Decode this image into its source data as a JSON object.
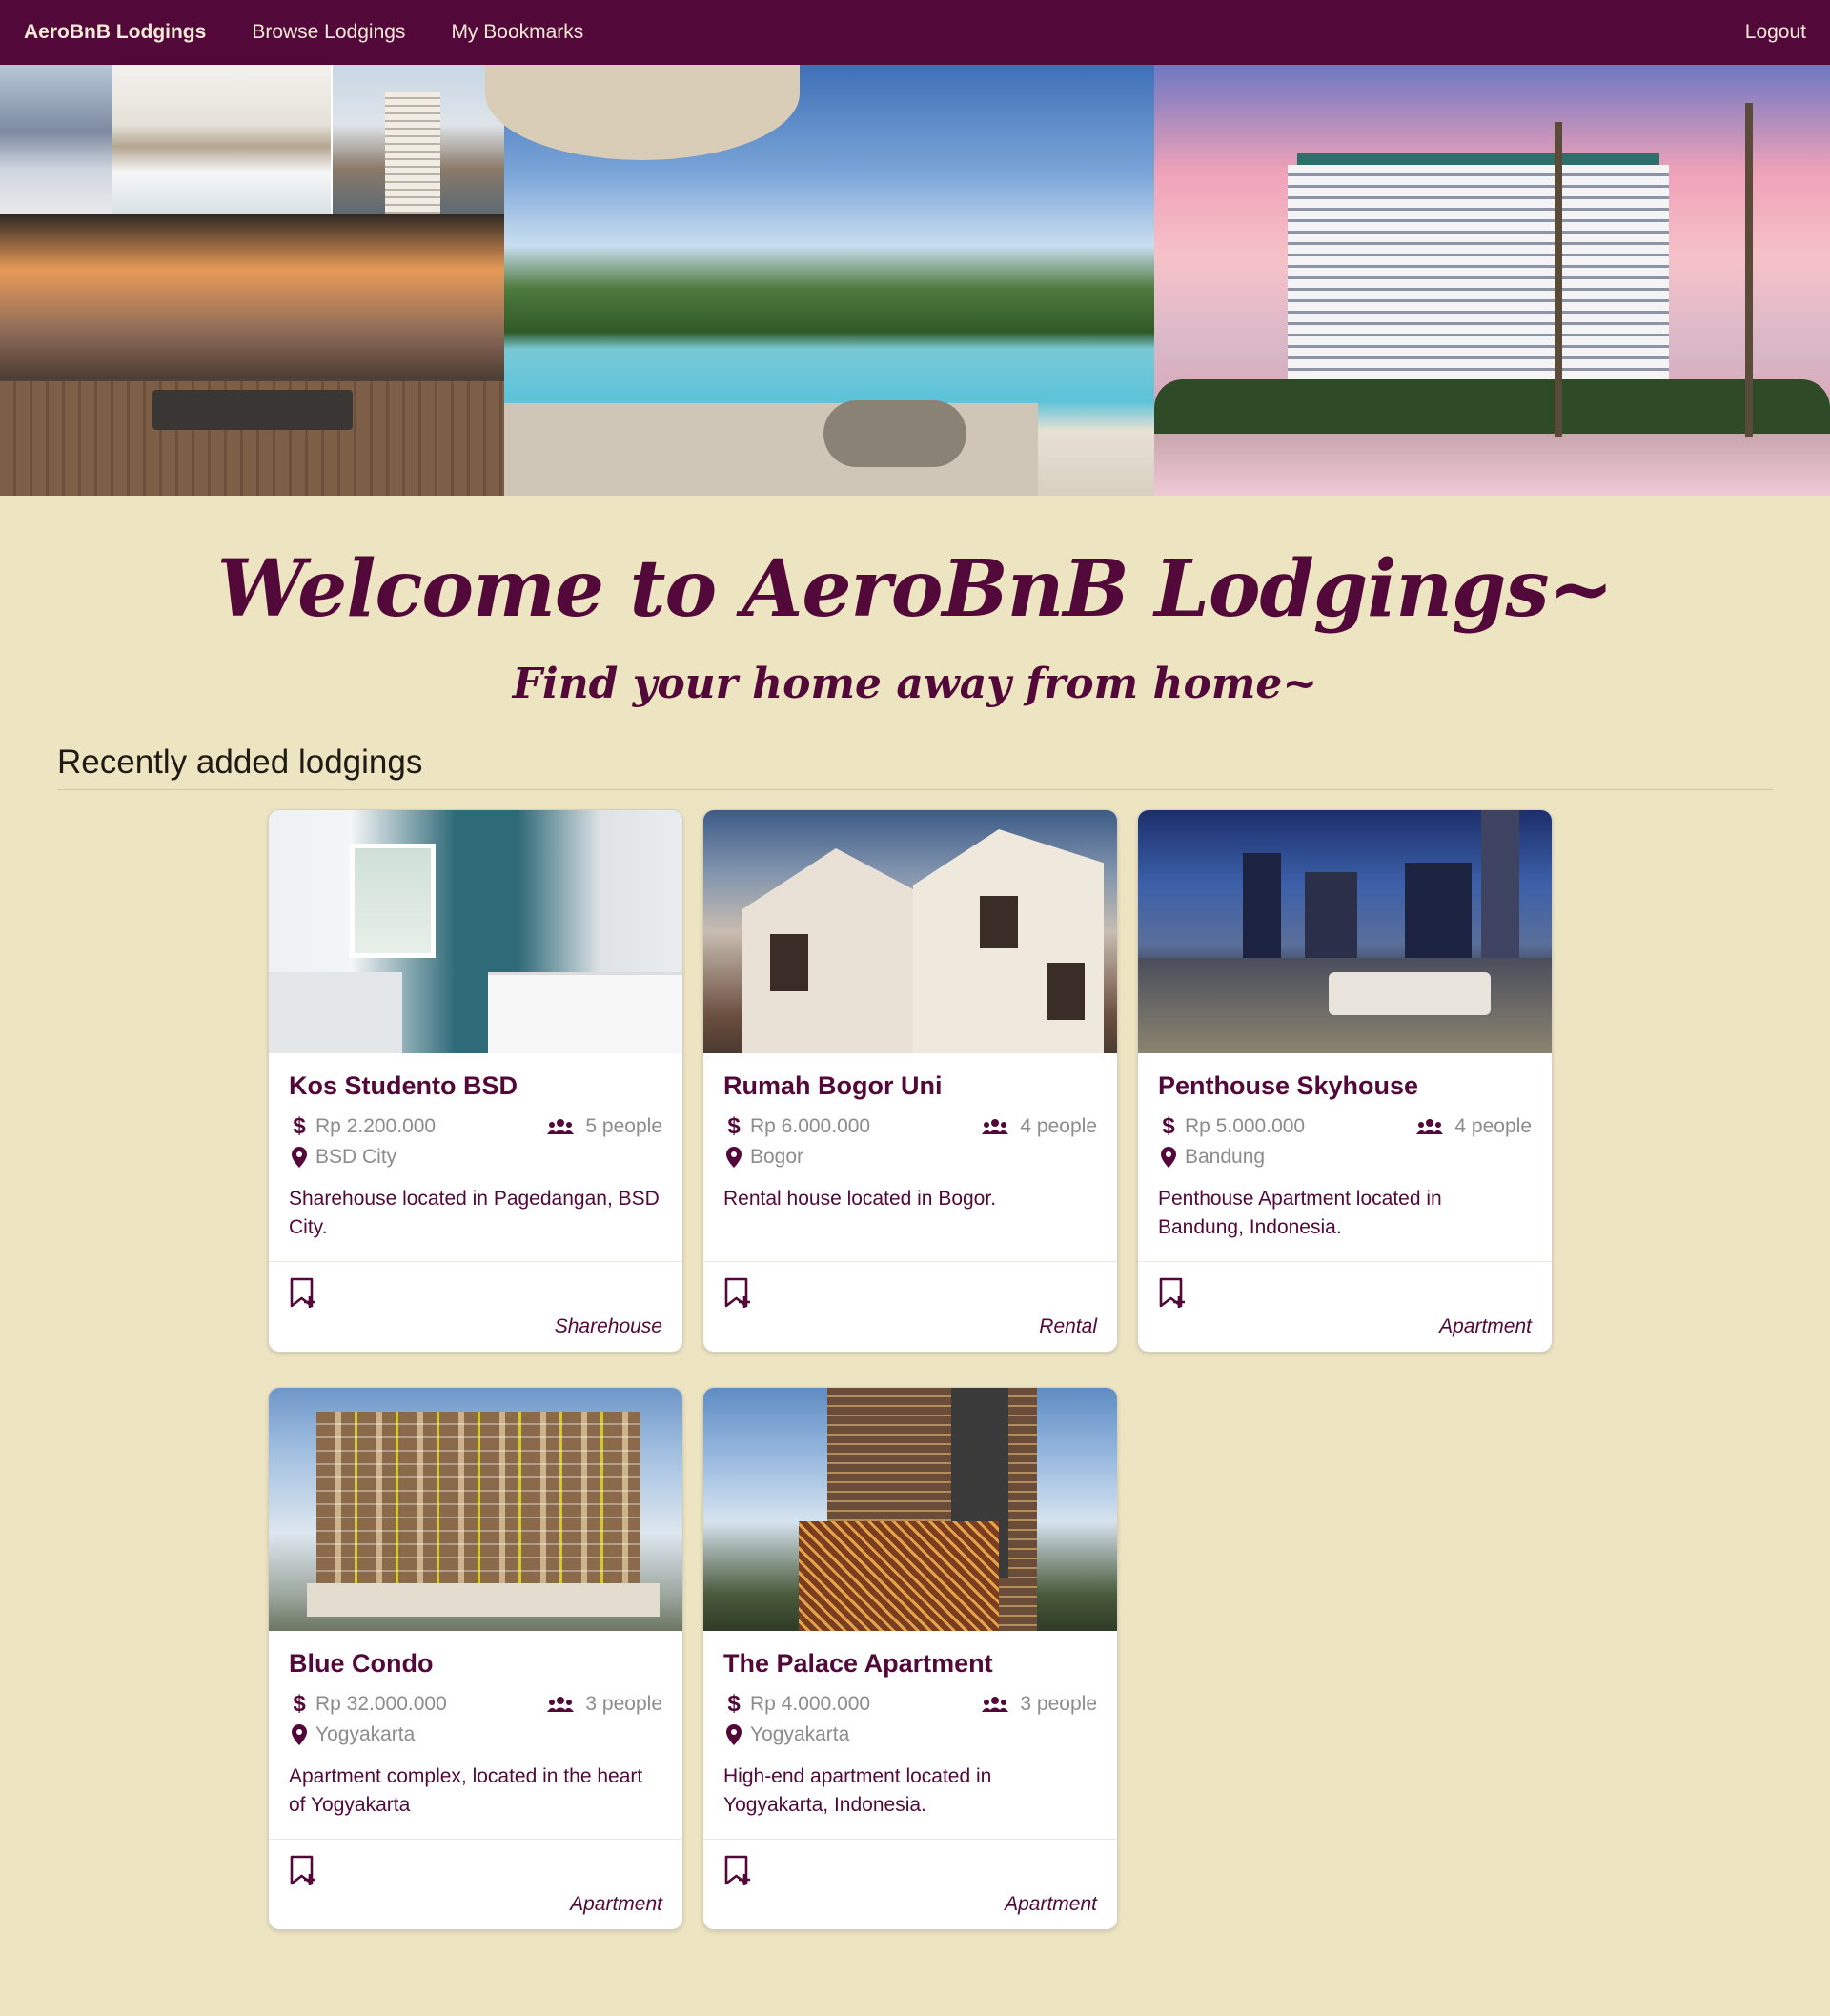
{
  "navbar": {
    "brand": "AeroBnB Lodgings",
    "links": [
      "Browse Lodgings",
      "My Bookmarks"
    ],
    "logout": "Logout"
  },
  "hero": {
    "images": [
      "hotel-rooms-collage",
      "resort-pool",
      "beachfront-hotel"
    ]
  },
  "welcome": {
    "title": "Welcome to AeroBnB Lodgings~",
    "tagline": "Find your home away from home~"
  },
  "section": {
    "heading": "Recently added lodgings"
  },
  "lodgings": [
    {
      "name": "Kos Studento BSD",
      "price": "Rp 2.200.000",
      "capacity": "5 people",
      "location": "BSD City",
      "description": "Sharehouse located in Pagedangan, BSD City.",
      "category": "Sharehouse",
      "image": "bedroom-photo"
    },
    {
      "name": "Rumah Bogor Uni",
      "price": "Rp 6.000.000",
      "capacity": "4 people",
      "location": "Bogor",
      "description": "Rental house located in Bogor.",
      "category": "Rental",
      "image": "house-exterior-photo"
    },
    {
      "name": "Penthouse Skyhouse",
      "price": "Rp 5.000.000",
      "capacity": "4 people",
      "location": "Bandung",
      "description": "Penthouse Apartment located in Bandung, Indonesia.",
      "category": "Apartment",
      "image": "penthouse-terrace-photo"
    },
    {
      "name": "Blue Condo",
      "price": "Rp 32.000.000",
      "capacity": "3 people",
      "location": "Yogyakarta",
      "description": "Apartment complex, located in the heart of Yogyakarta",
      "category": "Apartment",
      "image": "condo-building-photo"
    },
    {
      "name": "The Palace Apartment",
      "price": "Rp 4.000.000",
      "capacity": "3 people",
      "location": "Yogyakarta",
      "description": "High-end apartment located in Yogyakarta, Indonesia.",
      "category": "Apartment",
      "image": "palace-tower-photo"
    }
  ],
  "icons": {
    "price": "dollar-icon",
    "capacity": "people-icon",
    "location": "map-pin-icon",
    "bookmark": "bookmark-add-icon"
  },
  "colors": {
    "primary": "#520839",
    "background": "#ede4c2",
    "muted_text": "#8c8c8c",
    "card": "#ffffff"
  }
}
